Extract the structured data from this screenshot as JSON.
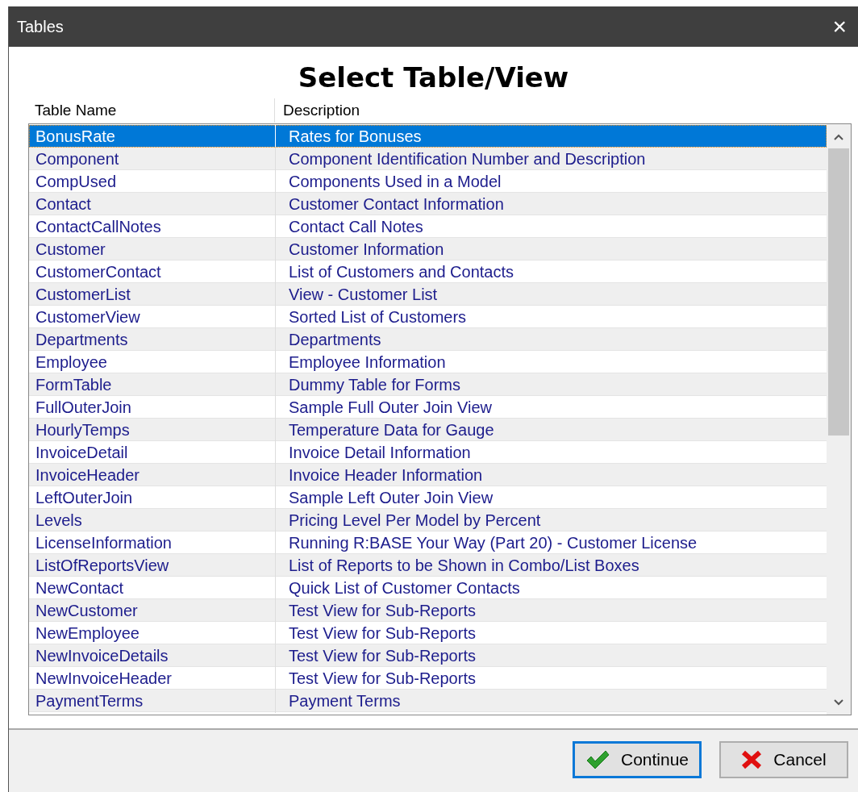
{
  "window": {
    "title": "Tables",
    "close": "×"
  },
  "heading": "Select Table/View",
  "table": {
    "columns": [
      "Table Name",
      "Description"
    ],
    "rows": [
      {
        "name": "BonusRate",
        "description": "Rates for Bonuses",
        "selected": true
      },
      {
        "name": "Component",
        "description": "Component Identification Number and Description",
        "selected": false
      },
      {
        "name": "CompUsed",
        "description": "Components Used in a Model",
        "selected": false
      },
      {
        "name": "Contact",
        "description": "Customer Contact Information",
        "selected": false
      },
      {
        "name": "ContactCallNotes",
        "description": "Contact Call Notes",
        "selected": false
      },
      {
        "name": "Customer",
        "description": "Customer Information",
        "selected": false
      },
      {
        "name": "CustomerContact",
        "description": "List of Customers and Contacts",
        "selected": false
      },
      {
        "name": "CustomerList",
        "description": "View - Customer List",
        "selected": false
      },
      {
        "name": "CustomerView",
        "description": "Sorted List of Customers",
        "selected": false
      },
      {
        "name": "Departments",
        "description": "Departments",
        "selected": false
      },
      {
        "name": "Employee",
        "description": "Employee Information",
        "selected": false
      },
      {
        "name": "FormTable",
        "description": "Dummy Table for Forms",
        "selected": false
      },
      {
        "name": "FullOuterJoin",
        "description": "Sample Full Outer Join View",
        "selected": false
      },
      {
        "name": "HourlyTemps",
        "description": "Temperature Data for Gauge",
        "selected": false
      },
      {
        "name": "InvoiceDetail",
        "description": "Invoice Detail Information",
        "selected": false
      },
      {
        "name": "InvoiceHeader",
        "description": "Invoice Header Information",
        "selected": false
      },
      {
        "name": "LeftOuterJoin",
        "description": "Sample Left Outer Join View",
        "selected": false
      },
      {
        "name": "Levels",
        "description": "Pricing Level Per Model by Percent",
        "selected": false
      },
      {
        "name": "LicenseInformation",
        "description": "Running R:BASE Your Way (Part 20) - Customer License",
        "selected": false
      },
      {
        "name": "ListOfReportsView",
        "description": "List of Reports to be Shown in Combo/List Boxes",
        "selected": false
      },
      {
        "name": "NewContact",
        "description": "Quick List of Customer Contacts",
        "selected": false
      },
      {
        "name": "NewCustomer",
        "description": "Test View for Sub-Reports",
        "selected": false
      },
      {
        "name": "NewEmployee",
        "description": "Test View for Sub-Reports",
        "selected": false
      },
      {
        "name": "NewInvoiceDetails",
        "description": "Test View for Sub-Reports",
        "selected": false
      },
      {
        "name": "NewInvoiceHeader",
        "description": "Test View for Sub-Reports",
        "selected": false
      },
      {
        "name": "PaymentTerms",
        "description": "Payment Terms",
        "selected": false
      }
    ]
  },
  "buttons": [
    {
      "label": "Continue",
      "kind": "ok",
      "selected": true
    },
    {
      "label": "Cancel",
      "kind": "cancel",
      "selected": false
    }
  ]
}
